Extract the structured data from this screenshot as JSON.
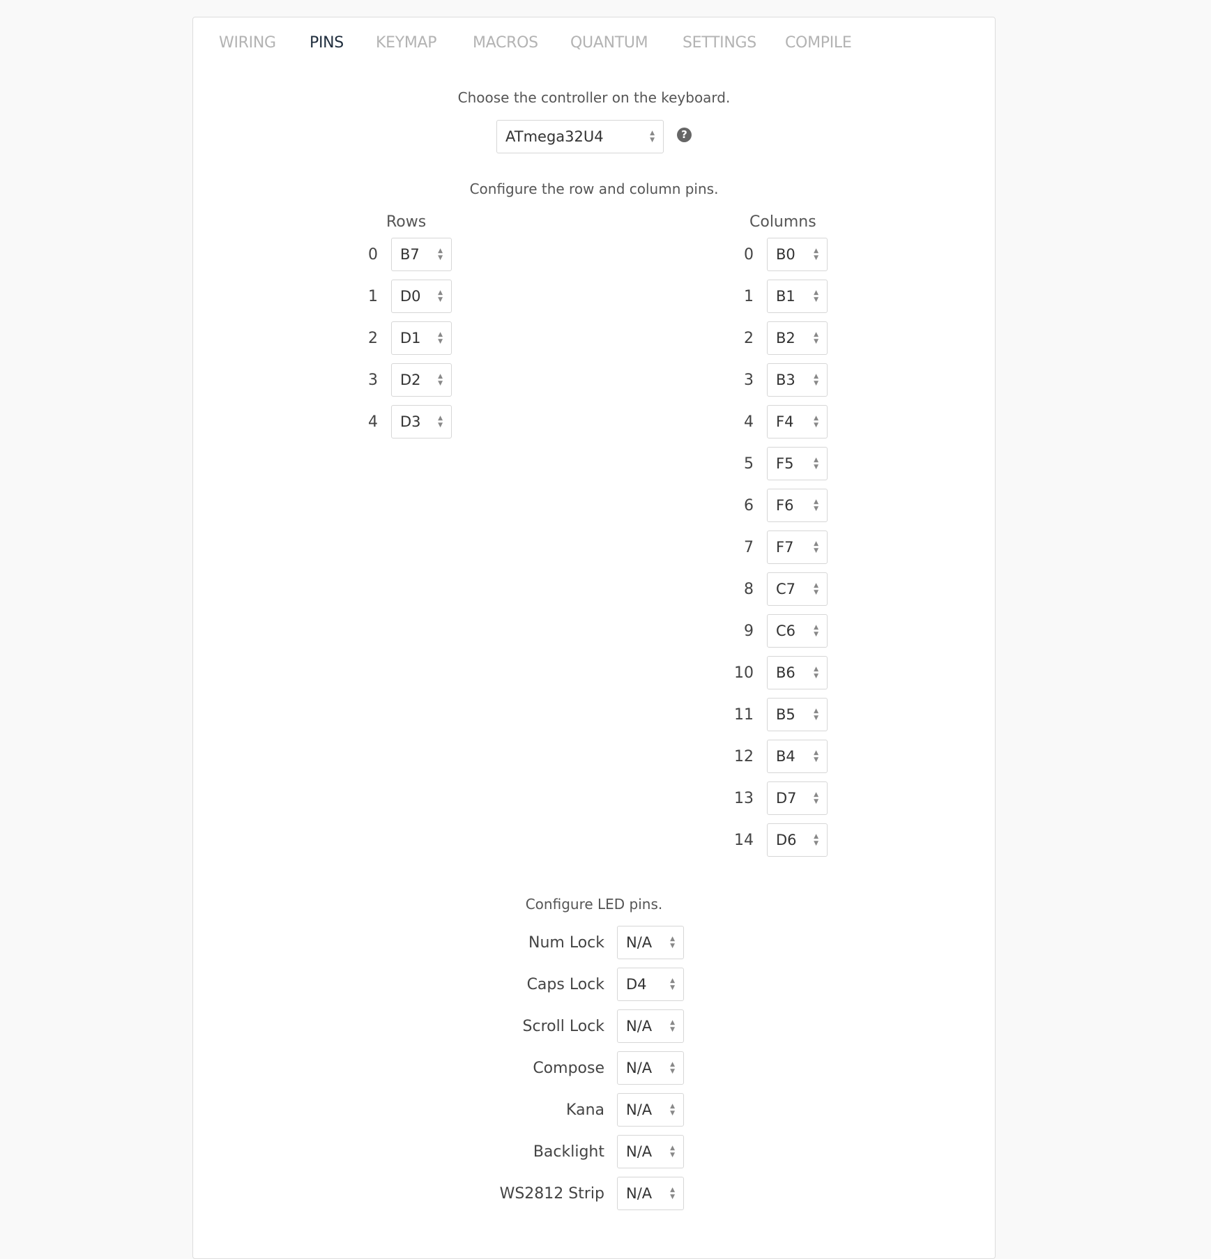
{
  "tabs": [
    {
      "label": "WIRING",
      "active": false
    },
    {
      "label": "PINS",
      "active": true
    },
    {
      "label": "KEYMAP",
      "active": false
    },
    {
      "label": "MACROS",
      "active": false
    },
    {
      "label": "QUANTUM",
      "active": false
    },
    {
      "label": "SETTINGS",
      "active": false
    },
    {
      "label": "COMPILE",
      "active": false
    }
  ],
  "controller": {
    "prompt": "Choose the controller on the keyboard.",
    "selected": "ATmega32U4",
    "help_icon": "question-circle-icon"
  },
  "matrix": {
    "prompt": "Configure the row and column pins.",
    "rows_header": "Rows",
    "columns_header": "Columns",
    "rows": [
      {
        "index": "0",
        "pin": "B7"
      },
      {
        "index": "1",
        "pin": "D0"
      },
      {
        "index": "2",
        "pin": "D1"
      },
      {
        "index": "3",
        "pin": "D2"
      },
      {
        "index": "4",
        "pin": "D3"
      }
    ],
    "columns": [
      {
        "index": "0",
        "pin": "B0"
      },
      {
        "index": "1",
        "pin": "B1"
      },
      {
        "index": "2",
        "pin": "B2"
      },
      {
        "index": "3",
        "pin": "B3"
      },
      {
        "index": "4",
        "pin": "F4"
      },
      {
        "index": "5",
        "pin": "F5"
      },
      {
        "index": "6",
        "pin": "F6"
      },
      {
        "index": "7",
        "pin": "F7"
      },
      {
        "index": "8",
        "pin": "C7"
      },
      {
        "index": "9",
        "pin": "C6"
      },
      {
        "index": "10",
        "pin": "B6"
      },
      {
        "index": "11",
        "pin": "B5"
      },
      {
        "index": "12",
        "pin": "B4"
      },
      {
        "index": "13",
        "pin": "D7"
      },
      {
        "index": "14",
        "pin": "D6"
      }
    ]
  },
  "led": {
    "prompt": "Configure LED pins.",
    "items": [
      {
        "label": "Num Lock",
        "pin": "N/A"
      },
      {
        "label": "Caps Lock",
        "pin": "D4"
      },
      {
        "label": "Scroll Lock",
        "pin": "N/A"
      },
      {
        "label": "Compose",
        "pin": "N/A"
      },
      {
        "label": "Kana",
        "pin": "N/A"
      },
      {
        "label": "Backlight",
        "pin": "N/A"
      },
      {
        "label": "WS2812 Strip",
        "pin": "N/A"
      }
    ]
  },
  "colors": {
    "active_tab": "#1f2d3d",
    "inactive_tab": "#b3b3b3",
    "border": "#d6d6d6"
  }
}
